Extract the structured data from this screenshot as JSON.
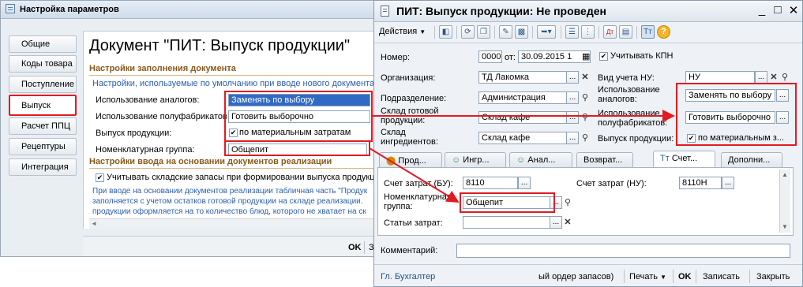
{
  "left_window": {
    "title": "Настройка параметров",
    "nav": [
      "Общие",
      "Коды товара",
      "Поступление",
      "Выпуск",
      "Расчет ППЦ",
      "Рецептуры",
      "Интеграция"
    ],
    "doc_title": "Документ \"ПИТ: Выпуск продукции\"",
    "section1": "Настройки заполнения документа",
    "section1_note": "Настройки, используемые по умолчанию при вводе нового документа.",
    "fields": [
      {
        "label": "Использование аналогов:",
        "value": "Заменять по выбору"
      },
      {
        "label": "Использование полуфабрикатов:",
        "value": "Готовить выборочно"
      },
      {
        "label": "Выпуск продукции:",
        "value": "по материальным затратам"
      },
      {
        "label": "Номенклатурная группа:",
        "value": "Общепит"
      }
    ],
    "section2": "Настройки ввода на основании документов реализации",
    "section2_checkbox": "Учитывать складские запасы при формировании выпуска продукции",
    "section2_note": [
      "При вводе на основании документов реализации табличная часть \"Продук",
      "заполняется с учетом остатков готовой продукции на складе реализации.",
      "продукции оформляется на то количество блюд, которого не хватает на ск"
    ],
    "bottom": {
      "ok": "OK",
      "partial": "З"
    }
  },
  "right_window": {
    "title": "ПИТ: Выпуск продукции: Не проведен",
    "controls": {
      "minimize": "_",
      "maximize": "□",
      "close": "✕"
    },
    "toolbar": {
      "actions": "Действия"
    },
    "number_label": "Номер:",
    "number_value": "0000",
    "date_label": "от:",
    "date_value": "30.09.2015 1",
    "kpn_label": "Учитывать КПН",
    "org_label": "Организация:",
    "org_value": "ТД Лакомка",
    "nu_label": "Вид учета НУ:",
    "nu_value": "НУ",
    "dept_label": "Подразделение:",
    "dept_value": "Администрация",
    "analog_label": [
      "Использование",
      "аналогов:"
    ],
    "analog_value": "Заменять по выбору",
    "store_label": [
      "Склад готовой",
      "продукции:"
    ],
    "store_value": "Склад кафе",
    "semi_label": [
      "Использование",
      "полуфабрикатов:"
    ],
    "semi_value": "Готовить выборочно",
    "ingr_label": [
      "Склад",
      "ингредиентов:"
    ],
    "ingr_value": "Склад кафе",
    "output_label": "Выпуск продукции:",
    "output_value": "по материальным з...",
    "tabs": [
      "Прод...",
      "Ингр...",
      "Анал...",
      "Возврат...",
      "Счет...",
      "Дополни..."
    ],
    "acc_bu_label": "Счет затрат (БУ):",
    "acc_bu_value": "8110",
    "acc_nu_label": "Счет затрат (НУ):",
    "acc_nu_value": "8110Н",
    "nomgroup_label": [
      "Номенклатурная",
      "группа:"
    ],
    "nomgroup_value": "Общепит",
    "costs_label": "Статьи затрат:",
    "comment_label": "Комментарий:",
    "status": {
      "accountant": "Гл. Бухгалтер",
      "partial_item": "ый ордер запасов)",
      "print": "Печать",
      "ok": "OK",
      "save": "Записать",
      "close": "Закрыть"
    }
  }
}
